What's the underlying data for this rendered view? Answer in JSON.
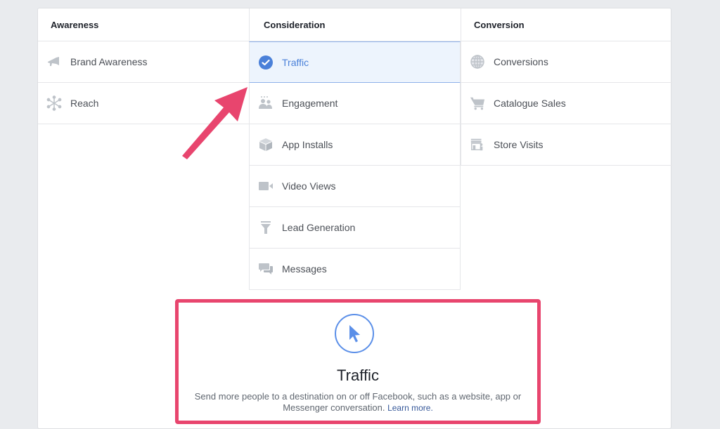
{
  "objectives": {
    "columns": [
      {
        "header": "Awareness",
        "items": [
          {
            "label": "Brand Awareness",
            "icon": "megaphone-icon"
          },
          {
            "label": "Reach",
            "icon": "reach-icon"
          }
        ]
      },
      {
        "header": "Consideration",
        "items": [
          {
            "label": "Traffic",
            "icon": "check-circle-icon",
            "selected": true
          },
          {
            "label": "Engagement",
            "icon": "people-icon"
          },
          {
            "label": "App Installs",
            "icon": "box-icon"
          },
          {
            "label": "Video Views",
            "icon": "video-camera-icon"
          },
          {
            "label": "Lead Generation",
            "icon": "funnel-icon"
          },
          {
            "label": "Messages",
            "icon": "chat-bubbles-icon"
          }
        ]
      },
      {
        "header": "Conversion",
        "items": [
          {
            "label": "Conversions",
            "icon": "globe-icon"
          },
          {
            "label": "Catalogue Sales",
            "icon": "shopping-cart-icon"
          },
          {
            "label": "Store Visits",
            "icon": "store-icon"
          }
        ]
      }
    ]
  },
  "detail": {
    "icon": "cursor-icon",
    "title": "Traffic",
    "description": "Send more people to a destination on or off Facebook, such as a website, app or Messenger conversation.",
    "learn_more": "Learn more."
  },
  "colors": {
    "accent": "#4a80d9",
    "highlight": "#e8456e",
    "background": "#e9ebee"
  }
}
